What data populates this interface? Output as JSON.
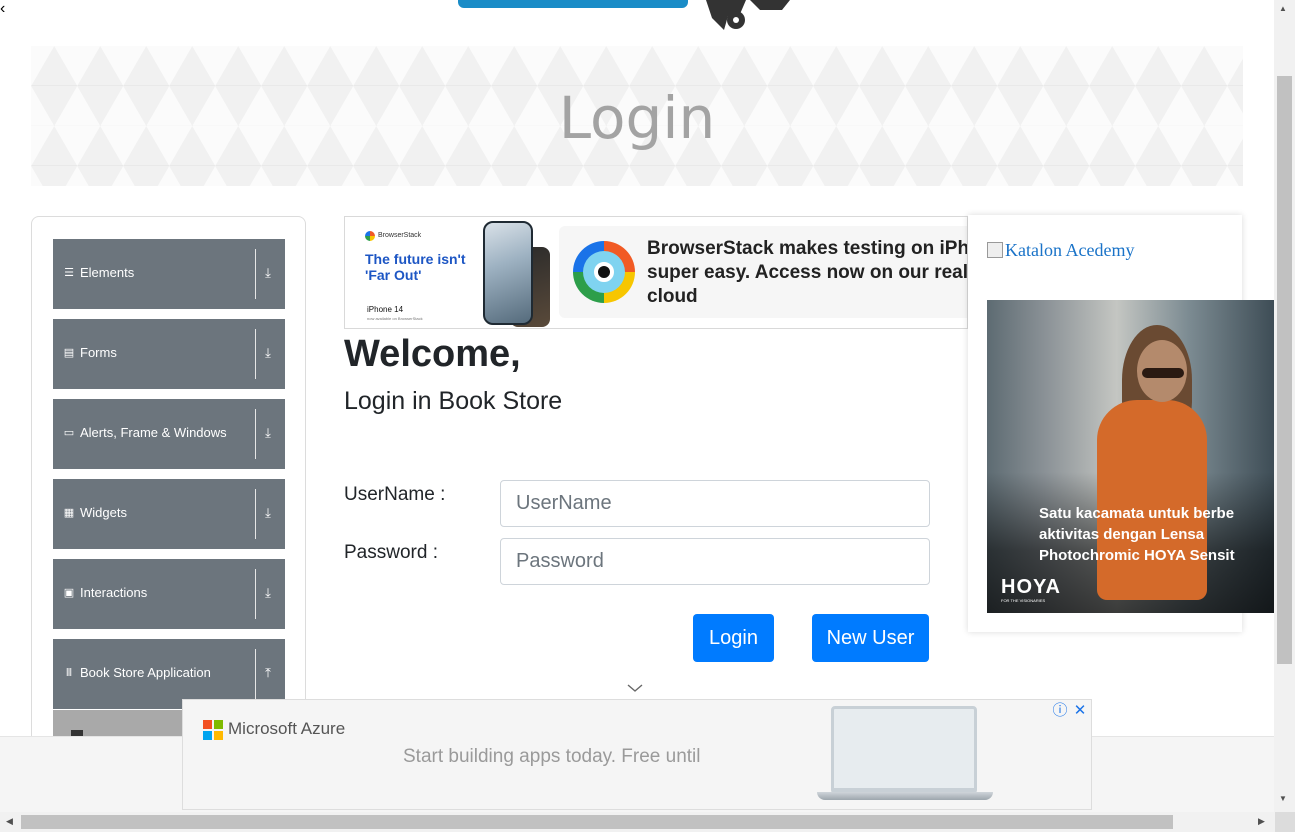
{
  "banner": {
    "title": "Login"
  },
  "sidebar": {
    "groups": [
      {
        "label": "Elements",
        "icon": "list-icon",
        "arrow": "download-arrow"
      },
      {
        "label": "Forms",
        "icon": "form-icon",
        "arrow": "download-arrow"
      },
      {
        "label": "Alerts, Frame & Windows",
        "icon": "window-icon",
        "arrow": "download-arrow"
      },
      {
        "label": "Widgets",
        "icon": "grid-icon",
        "arrow": "download-arrow"
      },
      {
        "label": "Interactions",
        "icon": "square-icon",
        "arrow": "download-arrow"
      },
      {
        "label": "Book Store Application",
        "icon": "books-icon",
        "arrow": "upload-arrow"
      }
    ]
  },
  "ad_top": {
    "brand": "BrowserStack",
    "headline": "The future isn't 'Far Out'",
    "device": "iPhone 14",
    "device_sub": "now available on BrowserStack",
    "text_line1": "BrowserStack makes testing on iPho",
    "text_line2": "super easy. Access now on our real",
    "text_line3": "cloud"
  },
  "main": {
    "welcome": "Welcome,",
    "subtitle": "Login in Book Store",
    "username_label": "UserName :",
    "username_placeholder": "UserName",
    "password_label": "Password :",
    "password_placeholder": "Password",
    "login_button": "Login",
    "new_user_button": "New User"
  },
  "ad_right": {
    "katalon_alt": "Katalon Acedemy",
    "tagline_1": "Satu kacamata untuk berbe",
    "tagline_2": "aktivitas dengan Lensa",
    "tagline_3": "Photochromic HOYA Sensit",
    "brand": "HOYA",
    "brand_sub": "FOR THE VISIONARIES"
  },
  "ad_bottom": {
    "brand": "Microsoft Azure",
    "tagline": "Start building apps today. Free until",
    "colors": [
      "#f25022",
      "#7fba00",
      "#00a4ef",
      "#ffb900"
    ]
  }
}
